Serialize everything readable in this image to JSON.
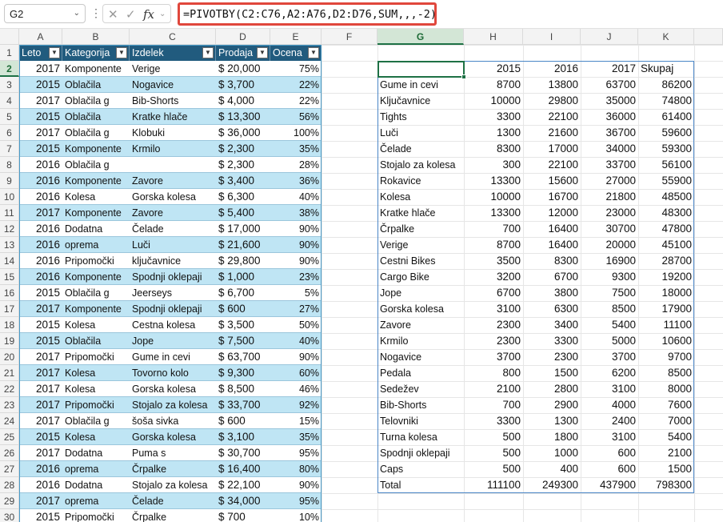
{
  "name_box": "G2",
  "formula": "=PIVOTBY(C2:C76,A2:A76,D2:D76,SUM,,,-2)",
  "columns": [
    "A",
    "B",
    "C",
    "D",
    "E",
    "F",
    "G",
    "H",
    "I",
    "J",
    "K"
  ],
  "rows": [
    "1",
    "2",
    "3",
    "4",
    "5",
    "6",
    "7",
    "8",
    "9",
    "10",
    "11",
    "12",
    "13",
    "14",
    "15",
    "16",
    "17",
    "18",
    "19",
    "20",
    "21",
    "22",
    "23",
    "24",
    "25",
    "26",
    "27",
    "28",
    "29",
    "30"
  ],
  "table_headers": [
    "Leto",
    "Kategorija",
    "Izdelek",
    "Prodaja",
    "Ocena"
  ],
  "table_rows": [
    [
      "2017",
      "Komponente",
      "Verige",
      "$ 20,000",
      "75%"
    ],
    [
      "2015",
      "Oblačila",
      "Nogavice",
      "$ 3,700",
      "22%"
    ],
    [
      "2017",
      "Oblačila g",
      "Bib-Shorts",
      "$ 4,000",
      "22%"
    ],
    [
      "2015",
      "Oblačila",
      "Kratke hlače",
      "$ 13,300",
      "56%"
    ],
    [
      "2017",
      "Oblačila g",
      "Klobuki",
      "$ 36,000",
      "100%"
    ],
    [
      "2015",
      "Komponente",
      "Krmilo",
      "$ 2,300",
      "35%"
    ],
    [
      "2016",
      "Oblačila g",
      "",
      "$ 2,300",
      "28%"
    ],
    [
      "2016",
      "Komponente",
      "Zavore",
      "$ 3,400",
      "36%"
    ],
    [
      "2016",
      "Kolesa",
      "Gorska kolesa",
      "$ 6,300",
      "40%"
    ],
    [
      "2017",
      "Komponente",
      "Zavore",
      "$ 5,400",
      "38%"
    ],
    [
      "2016",
      "Dodatna",
      "Čelade",
      "$ 17,000",
      "90%"
    ],
    [
      "2016",
      "oprema",
      "Luči",
      "$ 21,600",
      "90%"
    ],
    [
      "2016",
      "Pripomočki",
      "ključavnice",
      "$ 29,800",
      "90%"
    ],
    [
      "2016",
      "Komponente",
      "Spodnji oklepaji",
      "$ 1,000",
      "23%"
    ],
    [
      "2015",
      "Oblačila g",
      "Jeerseys",
      "$ 6,700",
      "5%"
    ],
    [
      "2017",
      "Komponente",
      "Spodnji oklepaji",
      "$ 600",
      "27%"
    ],
    [
      "2015",
      "Kolesa",
      "Cestna kolesa",
      "$ 3,500",
      "50%"
    ],
    [
      "2015",
      "Oblačila",
      "Jope",
      "$ 7,500",
      "40%"
    ],
    [
      "2017",
      "Pripomočki",
      "Gume in cevi",
      "$ 63,700",
      "90%"
    ],
    [
      "2017",
      "Kolesa",
      "Tovorno kolo",
      "$ 9,300",
      "60%"
    ],
    [
      "2017",
      "Kolesa",
      "Gorska kolesa",
      "$ 8,500",
      "46%"
    ],
    [
      "2017",
      "Pripomočki",
      "Stojalo za kolesa",
      "$ 33,700",
      "92%"
    ],
    [
      "2017",
      "Oblačila g",
      "šoša sivka",
      "$ 600",
      "15%"
    ],
    [
      "2015",
      "Kolesa",
      "Gorska kolesa",
      "$ 3,100",
      "35%"
    ],
    [
      "2017",
      "Dodatna",
      "Puma s",
      "$ 30,700",
      "95%"
    ],
    [
      "2016",
      "oprema",
      "Črpalke",
      "$ 16,400",
      "80%"
    ],
    [
      "2016",
      "Dodatna",
      "Stojalo za kolesa",
      "$ 22,100",
      "90%"
    ],
    [
      "2017",
      "oprema",
      "Čelade",
      "$ 34,000",
      "95%"
    ],
    [
      "2015",
      "Pripomočki",
      "Črpalke",
      "$ 700",
      "10%"
    ]
  ],
  "pivot_headers": [
    "",
    "2015",
    "2016",
    "2017",
    "Skupaj"
  ],
  "pivot_rows": [
    [
      "Gume in cevi",
      "8700",
      "13800",
      "63700",
      "86200"
    ],
    [
      "Ključavnice",
      "10000",
      "29800",
      "35000",
      "74800"
    ],
    [
      "Tights",
      "3300",
      "22100",
      "36000",
      "61400"
    ],
    [
      "Luči",
      "1300",
      "21600",
      "36700",
      "59600"
    ],
    [
      "Čelade",
      "8300",
      "17000",
      "34000",
      "59300"
    ],
    [
      "Stojalo za kolesa",
      "300",
      "22100",
      "33700",
      "56100"
    ],
    [
      "Rokavice",
      "13300",
      "15600",
      "27000",
      "55900"
    ],
    [
      "Kolesa",
      "10000",
      "16700",
      "21800",
      "48500"
    ],
    [
      "Kratke hlače",
      "13300",
      "12000",
      "23000",
      "48300"
    ],
    [
      "Črpalke",
      "700",
      "16400",
      "30700",
      "47800"
    ],
    [
      "Verige",
      "8700",
      "16400",
      "20000",
      "45100"
    ],
    [
      "Cestni Bikes",
      "3500",
      "8300",
      "16900",
      "28700"
    ],
    [
      "Cargo Bike",
      "3200",
      "6700",
      "9300",
      "19200"
    ],
    [
      "Jope",
      "6700",
      "3800",
      "7500",
      "18000"
    ],
    [
      "Gorska kolesa",
      "3100",
      "6300",
      "8500",
      "17900"
    ],
    [
      "Zavore",
      "2300",
      "3400",
      "5400",
      "11100"
    ],
    [
      "Krmilo",
      "2300",
      "3300",
      "5000",
      "10600"
    ],
    [
      "Nogavice",
      "3700",
      "2300",
      "3700",
      "9700"
    ],
    [
      "Pedala",
      "800",
      "1500",
      "6200",
      "8500"
    ],
    [
      "Sedežev",
      "2100",
      "2800",
      "3100",
      "8000"
    ],
    [
      "Bib-Shorts",
      "700",
      "2900",
      "4000",
      "7600"
    ],
    [
      "Telovniki",
      "3300",
      "1300",
      "2400",
      "7000"
    ],
    [
      "Turna kolesa",
      "500",
      "1800",
      "3100",
      "5400"
    ],
    [
      "Spodnji oklepaji",
      "500",
      "1000",
      "600",
      "2100"
    ],
    [
      "Caps",
      "500",
      "400",
      "600",
      "1500"
    ],
    [
      "Total",
      "111100",
      "249300",
      "437900",
      "798300"
    ]
  ],
  "colors": {
    "table_header": "#215b7e",
    "band": "#bfe5f4",
    "selected": "#1e7145",
    "formula_outline": "#e0473c"
  }
}
